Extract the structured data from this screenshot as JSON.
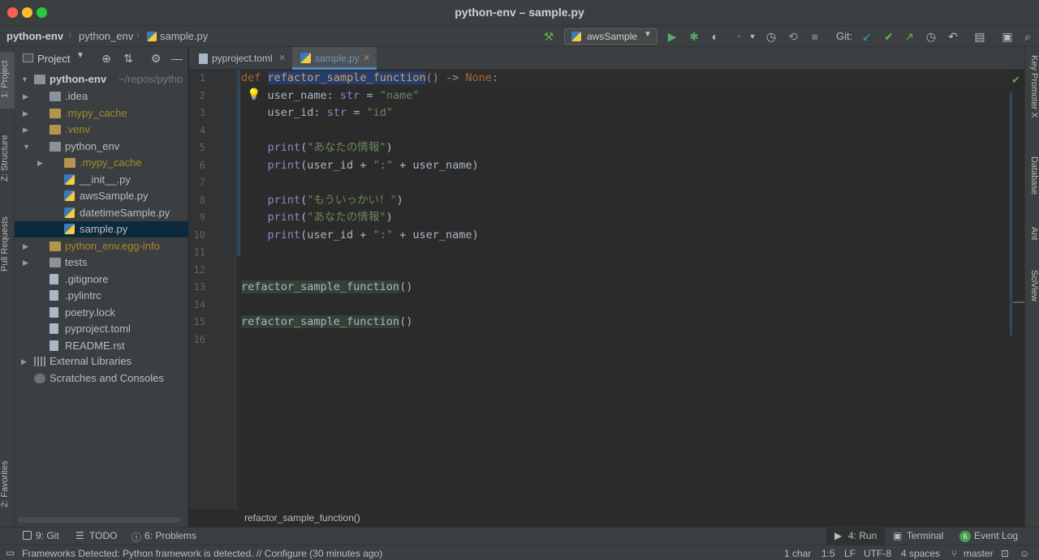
{
  "window": {
    "title": "python-env – sample.py"
  },
  "navbar": {
    "crumbs": [
      "python-env",
      "python_env",
      "sample.py"
    ],
    "run_config": "awsSample",
    "git_label": "Git:"
  },
  "colors": {
    "accent": "#4a88c7",
    "selection": "#0d293e",
    "excluded_folder": "#a38a2a"
  },
  "left_strip": {
    "project": "1: Project",
    "structure": "Z: Structure",
    "pull_requests": "Pull Requests",
    "favorites": "2: Favorites"
  },
  "project_panel": {
    "title": "Project",
    "root_name": "python-env",
    "root_path": "~/repos/pytho",
    "items": [
      {
        "label": ".idea",
        "kind": "folder",
        "depth": 1,
        "expandable": true,
        "excluded": false
      },
      {
        "label": ".mypy_cache",
        "kind": "folder",
        "depth": 1,
        "expandable": true,
        "excluded": true
      },
      {
        "label": ".venv",
        "kind": "folder",
        "depth": 1,
        "expandable": true,
        "excluded": true
      },
      {
        "label": "python_env",
        "kind": "folder",
        "depth": 1,
        "expandable": true,
        "expanded": true,
        "excluded": false
      },
      {
        "label": ".mypy_cache",
        "kind": "folder",
        "depth": 2,
        "expandable": true,
        "excluded": true
      },
      {
        "label": "__init__.py",
        "kind": "py",
        "depth": 2
      },
      {
        "label": "awsSample.py",
        "kind": "py",
        "depth": 2
      },
      {
        "label": "datetimeSample.py",
        "kind": "py",
        "depth": 2
      },
      {
        "label": "sample.py",
        "kind": "py",
        "depth": 2,
        "selected": true
      },
      {
        "label": "python_env.egg-info",
        "kind": "folder",
        "depth": 1,
        "expandable": true,
        "excluded": true
      },
      {
        "label": "tests",
        "kind": "folder",
        "depth": 1,
        "expandable": true,
        "excluded": false
      },
      {
        "label": ".gitignore",
        "kind": "file",
        "depth": 1
      },
      {
        "label": ".pylintrc",
        "kind": "file",
        "depth": 1
      },
      {
        "label": "poetry.lock",
        "kind": "file",
        "depth": 1
      },
      {
        "label": "pyproject.toml",
        "kind": "file",
        "depth": 1
      },
      {
        "label": "README.rst",
        "kind": "file",
        "depth": 1
      }
    ],
    "external_libraries": "External Libraries",
    "scratches": "Scratches and Consoles"
  },
  "editor": {
    "tabs": [
      {
        "label": "pyproject.toml",
        "active": false
      },
      {
        "label": "sample.py",
        "active": true
      }
    ],
    "line_numbers": [
      "1",
      "2",
      "3",
      "4",
      "5",
      "6",
      "7",
      "8",
      "9",
      "10",
      "11",
      "12",
      "13",
      "14",
      "15",
      "16"
    ],
    "lines": {
      "l1_def": "def",
      "l1_fn": "refactor_sample_function",
      "l1_rest": "() -> ",
      "l1_none": "None",
      "l1_colon": ":",
      "l2_a": "    user_name: ",
      "l2_type": "str",
      "l2_b": " = ",
      "l2_str": "\"name\"",
      "l3_a": "    user_id: ",
      "l3_type": "str",
      "l3_b": " = ",
      "l3_str": "\"id\"",
      "print": "print",
      "l5_str": "\"あなたの情報\"",
      "l6_args": "(user_id + ",
      "l6_str": "\":\"",
      "l6_end": " + user_name)",
      "l8_str": "\"もういっかい！\"",
      "l9_str": "\"あなたの情報\"",
      "call": "refactor_sample_function",
      "call_paren": "()"
    },
    "breadcrumb": "refactor_sample_function()"
  },
  "right_strip": {
    "key_promoter": "Key Promoter X",
    "database": "Database",
    "ant": "Ant",
    "sciview": "SciView"
  },
  "bottom_tabs": {
    "git": "9: Git",
    "todo": "TODO",
    "problems": "6: Problems",
    "run": "4: Run",
    "terminal": "Terminal",
    "event_log": "Event Log",
    "event_count": "6"
  },
  "status": {
    "message": "Frameworks Detected: Python framework is detected. // Configure (30 minutes ago)",
    "chars": "1 char",
    "position": "1:5",
    "line_sep": "LF",
    "encoding": "UTF-8",
    "indent": "4 spaces",
    "branch": "master"
  }
}
